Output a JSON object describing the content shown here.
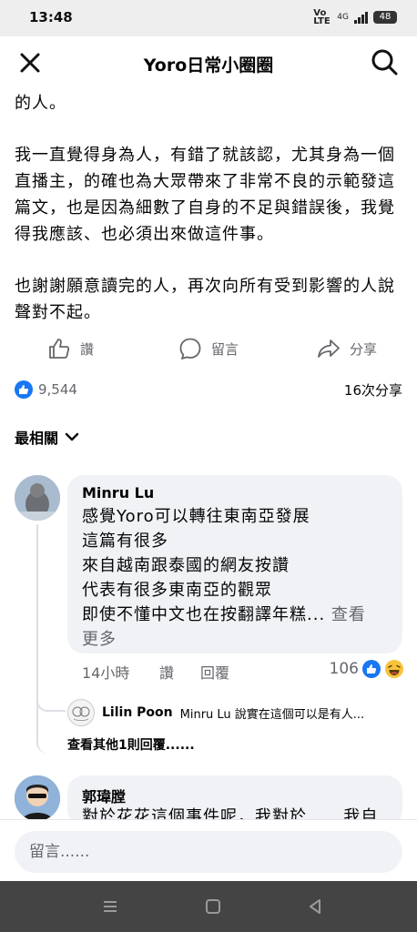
{
  "status": {
    "time": "13:48",
    "volte": "Vo LTE",
    "network": "4G",
    "battery": "48"
  },
  "header": {
    "title": "Yoro日常小圈圈"
  },
  "post": {
    "paragraphs": [
      "方面的不足，也曾積極尋求方法讓自己成為更成熟的人。",
      "我一直覺得身為人，有錯了就該認，尤其身為一個直播主，的確也為大眾帶來了非常不良的示範發這篇文，也是因為細數了自身的不足與錯誤後，我覺得我應該、也必須出來做這件事。",
      "也謝謝願意讀完的人，再次向所有受到影響的人說聲對不起。"
    ]
  },
  "actions": {
    "like": "讚",
    "comment": "留言",
    "share": "分享"
  },
  "stats": {
    "likes": "9,544",
    "shares": "16次分享"
  },
  "sort": {
    "label": "最相關"
  },
  "comments": [
    {
      "name": "Minru Lu",
      "lines": [
        "感覺Yoro可以轉往東南亞發展",
        "這篇有很多",
        "來自越南跟泰國的網友按讚",
        "代表有很多東南亞的觀眾",
        "即使不懂中文也在按翻譯年糕..."
      ],
      "see_more_1": " 查看",
      "see_more_2": "更多",
      "time": "14小時",
      "like": "讚",
      "reply": "回覆",
      "reaction_count": "106"
    },
    {
      "name": "郭瑋膛",
      "lines": [
        "對於花花這個事件呢，我對於......我自"
      ]
    }
  ],
  "reply_preview": {
    "name": "Lilin Poon",
    "text": "Minru Lu 說實在這個可以是有人..."
  },
  "more_replies": "查看其他1則回覆......",
  "composer": {
    "placeholder": "留言......"
  },
  "colors": {
    "accent": "#1877f2",
    "muted": "#65676b",
    "bubble": "#f0f2f5"
  }
}
